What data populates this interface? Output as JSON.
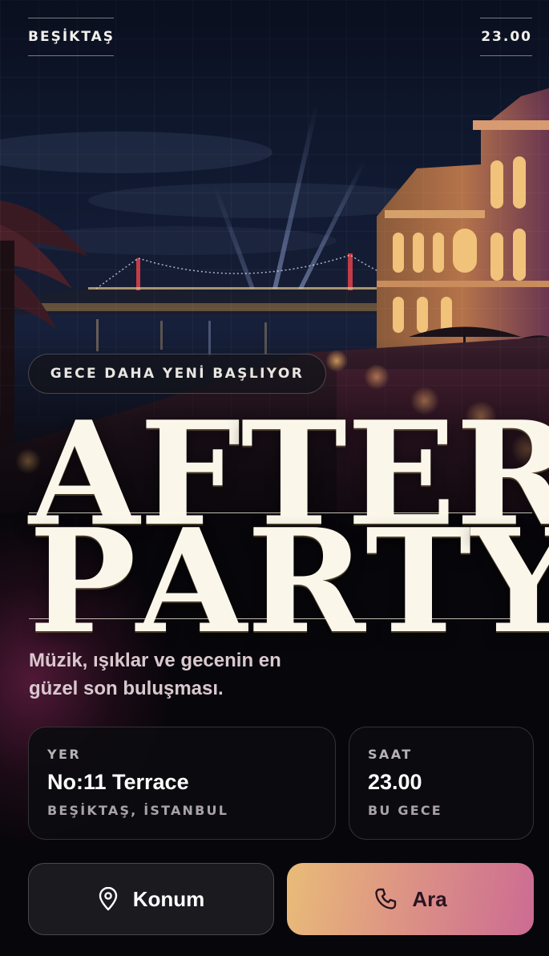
{
  "header": {
    "district": "BEŞİKTAŞ",
    "time": "23.00"
  },
  "hero": {
    "tagline": "GECE DAHA YENİ BAŞLIYOR",
    "title_line1": [
      "A",
      "F",
      "T",
      "E",
      "R"
    ],
    "title_line2": [
      "P",
      "A",
      "R",
      "T",
      "Y"
    ],
    "subtitle_line1": "Müzik, ışıklar ve gecenin en",
    "subtitle_line2": "güzel son buluşması."
  },
  "cards": {
    "place": {
      "label": "YER",
      "value": "No:11 Terrace",
      "sub": "BEŞİKTAŞ, İSTANBUL"
    },
    "time": {
      "label": "SAAT",
      "value": "23.00",
      "sub": "BU GECE"
    }
  },
  "actions": {
    "location_label": "Konum",
    "location_icon": "map-pin-icon",
    "call_label": "Ara",
    "call_icon": "phone-icon"
  },
  "colors": {
    "background": "#07060a",
    "title": "#fbf6ea",
    "call_gradient_start": "#e9bc78",
    "call_gradient_end": "#cc6b93"
  }
}
